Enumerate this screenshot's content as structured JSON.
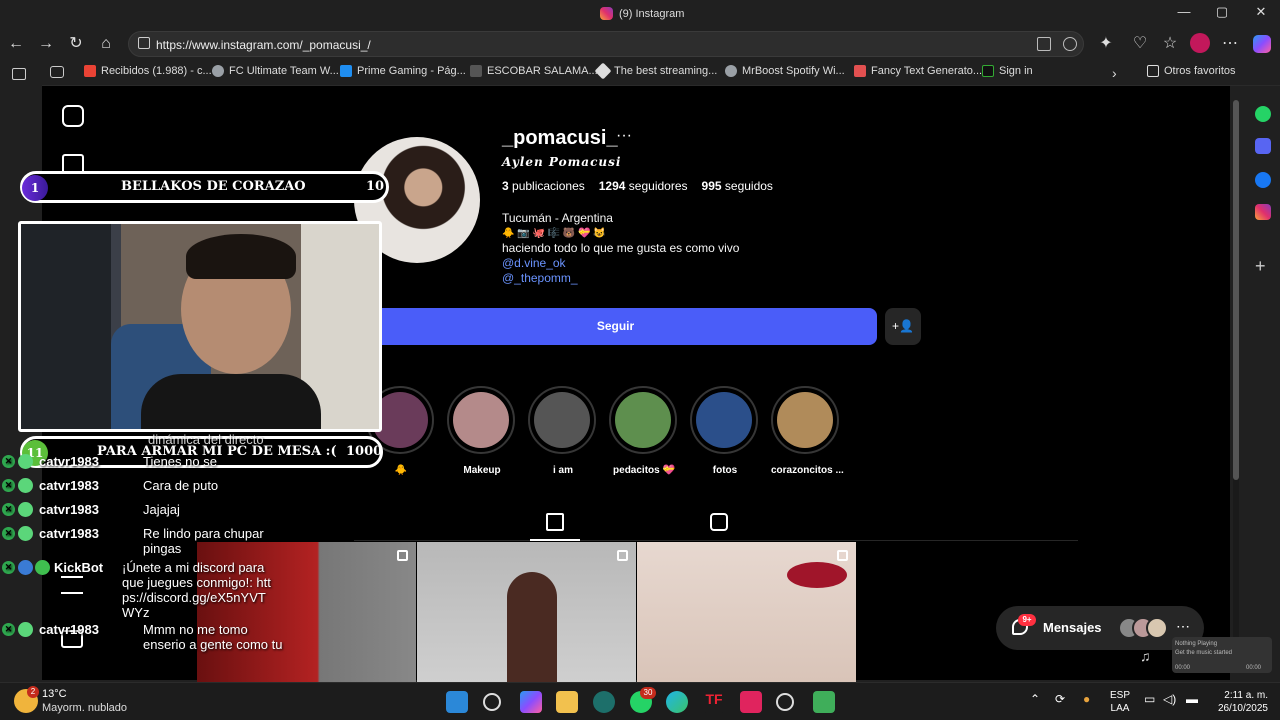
{
  "window": {
    "title": "(9) Instagram"
  },
  "address": {
    "url": "https://www.instagram.com/_pomacusi_/"
  },
  "bookmarks": [
    {
      "label": "Recibidos (1.988) - c...",
      "color": "#ea4335"
    },
    {
      "label": "FC Ultimate Team W...",
      "color": "#9aa0a6"
    },
    {
      "label": "Prime Gaming - Pág...",
      "color": "#1f8ef1"
    },
    {
      "label": "ESCOBAR SALAMA...",
      "color": "#555555"
    },
    {
      "label": "The best streaming...",
      "color": "#dddddd"
    },
    {
      "label": "MrBoost Spotify Wi...",
      "color": "#9aa0a6"
    },
    {
      "label": "Fancy Text Generato...",
      "color": "#e25050"
    },
    {
      "label": "Sign in",
      "color": "#111111"
    }
  ],
  "other_favorites": "Otros favoritos",
  "profile": {
    "username": "_pomacusi_",
    "full_name": "Aylen Pomacusi",
    "stats": {
      "posts_count": "3",
      "posts_label": "publicaciones",
      "followers_count": "1294",
      "followers_label": "seguidores",
      "following_count": "995",
      "following_label": "seguidos"
    },
    "bio": {
      "location": "Tucumán - Argentina",
      "emojis": "🐥 📷 🐙 🎼 🐻 💝 😺",
      "text": "haciendo todo lo que me gusta es como vivo",
      "link1": "@d.vine_ok",
      "link2": "@_thepomm_"
    },
    "follow_label": "Seguir",
    "add_user_icon": "+👤"
  },
  "highlights": [
    {
      "label": "🐥",
      "color": "#6a3b5a"
    },
    {
      "label": "Makeup",
      "color": "#b48a8a"
    },
    {
      "label": "i am",
      "color": "#555555"
    },
    {
      "label": "pedacitos 💝",
      "color": "#5e8f4e"
    },
    {
      "label": "fotos",
      "color": "#2b4f8a"
    },
    {
      "label": "corazoncitos ...",
      "color": "#b08b5a"
    }
  ],
  "messages": {
    "label": "Mensajes",
    "badge": "9+"
  },
  "now_playing": {
    "title": "Nothing Playing",
    "sub": "Get the music started",
    "t1": "00:00",
    "t2": "00:00"
  },
  "overlay": {
    "goal1": {
      "num": "1",
      "text": "BELLAKOS DE CORAZAO",
      "target": "10"
    },
    "goal2": {
      "num": "11",
      "text": "PARA ARMAR MI PC DE MESA :(",
      "target": "1000"
    }
  },
  "chat": [
    {
      "user": "",
      "msg": "dinámica del directo"
    },
    {
      "user": "catvr1983",
      "msg": "Tienes no se"
    },
    {
      "user": "catvr1983",
      "msg": "Cara de puto"
    },
    {
      "user": "catvr1983",
      "msg": "Jajajaj"
    },
    {
      "user": "catvr1983",
      "msg": "Re lindo para chupar pingas"
    },
    {
      "user": "KickBot",
      "msg": "¡Únete a mi discord para que juegues conmigo!: https://discord.gg/eX5nYVTWYz"
    },
    {
      "user": "catvr1983",
      "msg": "Mmm no me tomo enserio a gente como tu"
    }
  ],
  "taskbar": {
    "weather_temp": "13°C",
    "weather_desc": "Mayorm. nublado",
    "weather_badge": "2",
    "lang1": "ESP",
    "lang2": "LAA",
    "time": "2:11 a. m.",
    "date": "26/10/2025",
    "whatsapp_badge": "30"
  }
}
